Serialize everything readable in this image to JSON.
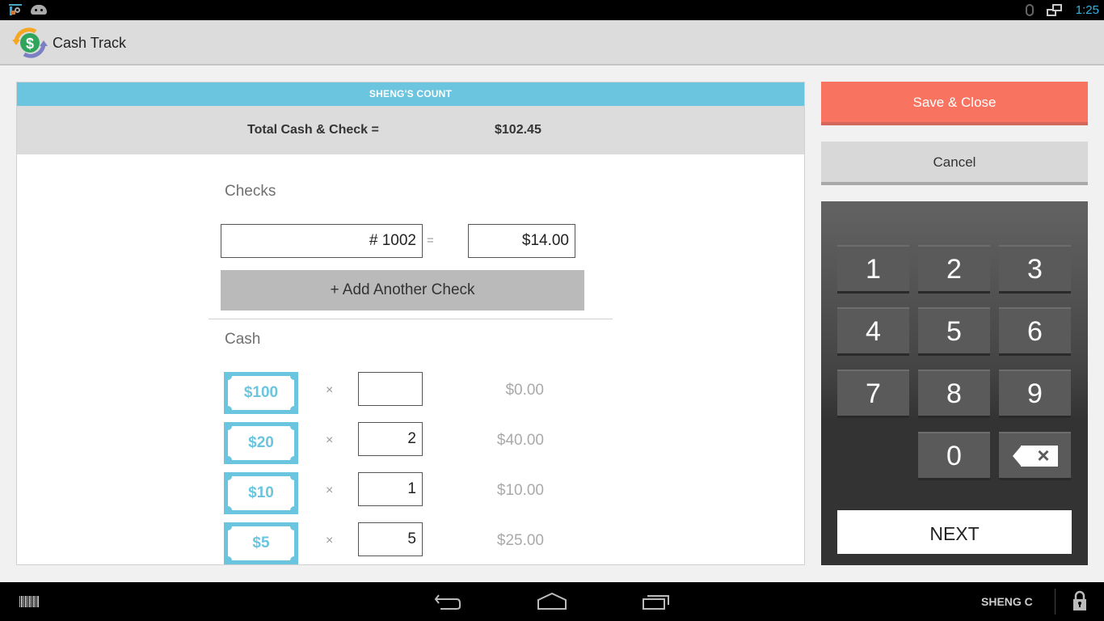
{
  "status_bar": {
    "time": "1:25",
    "icons": [
      "notification-app-icon",
      "android-debug-icon",
      "bluetooth-icon",
      "network-icon"
    ]
  },
  "action_bar": {
    "title": "Cash Track",
    "logo_icon": "cash-track-logo-icon"
  },
  "count_panel": {
    "header": "SHENG'S COUNT",
    "total_label": "Total Cash & Check =",
    "total_value": "$102.45",
    "checks": {
      "title": "Checks",
      "items": [
        {
          "number": "# 1002",
          "equals": "=",
          "amount": "$14.00"
        }
      ],
      "add_button": "+ Add Another Check"
    },
    "cash": {
      "title": "Cash",
      "times_symbol": "×",
      "rows": [
        {
          "denomination": "$100",
          "quantity": "",
          "subtotal": "$0.00"
        },
        {
          "denomination": "$20",
          "quantity": "2",
          "subtotal": "$40.00"
        },
        {
          "denomination": "$10",
          "quantity": "1",
          "subtotal": "$10.00"
        },
        {
          "denomination": "$5",
          "quantity": "5",
          "subtotal": "$25.00"
        }
      ]
    }
  },
  "side_actions": {
    "save_label": "Save & Close",
    "cancel_label": "Cancel",
    "colors": {
      "save": "#f87461",
      "cancel": "#d8d8d8",
      "accent": "#6bc5df"
    }
  },
  "keypad": {
    "keys": [
      "1",
      "2",
      "3",
      "4",
      "5",
      "6",
      "7",
      "8",
      "9",
      "0"
    ],
    "backspace_icon": "backspace-icon",
    "next_label": "NEXT"
  },
  "nav_bar": {
    "user": "SHENG C",
    "icons": [
      "barcode-icon",
      "back-icon",
      "home-icon",
      "recents-icon",
      "lock-icon"
    ]
  }
}
